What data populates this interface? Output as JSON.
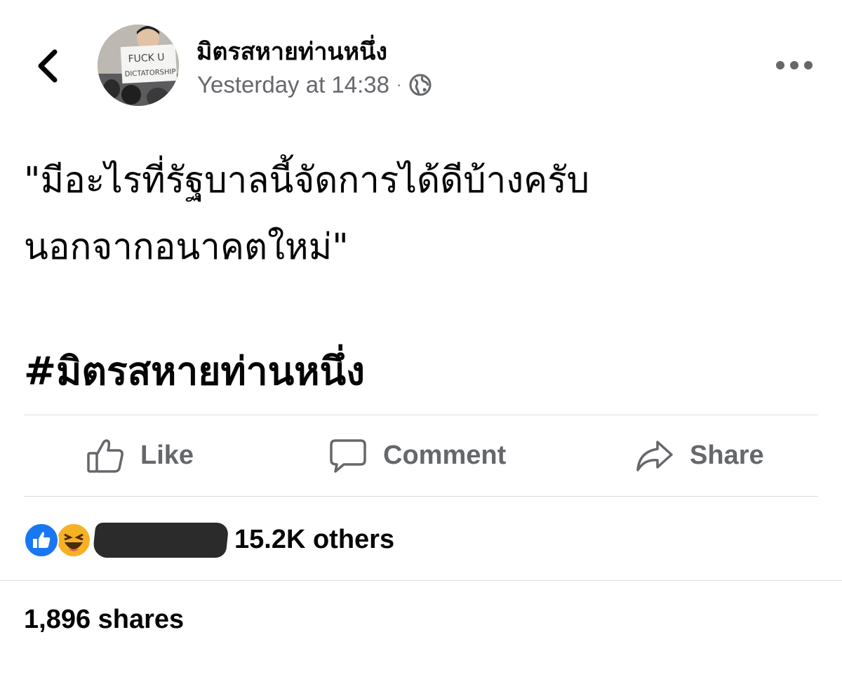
{
  "header": {
    "author_name": "มิตรสหายท่านหนึ่ง",
    "timestamp": "Yesterday at 14:38",
    "separator": "·",
    "privacy_icon": "globe-icon",
    "back_icon": "chevron-left-icon",
    "more_icon": "more-horizontal-icon",
    "avatar_sign_text": [
      "FUCK U",
      "DICTATORSHIP"
    ]
  },
  "post": {
    "text_lines": [
      "\"มีอะไรที่รัฐบาลนี้จัดการได้ดีบ้างครับ",
      "นอกจากอนาคตใหม่\""
    ],
    "hashtag": "#มิตรสหายท่านหนึ่ง"
  },
  "actions": {
    "like_label": "Like",
    "comment_label": "Comment",
    "share_label": "Share"
  },
  "reactions": {
    "icons": [
      "like-react-icon",
      "haha-react-icon"
    ],
    "summary_text": "15.2K others"
  },
  "shares": {
    "count_text": "1,896 shares"
  },
  "colors": {
    "text_primary": "#050505",
    "text_secondary": "#65676b",
    "divider": "#dadde1",
    "like_blue": "#1877f2",
    "haha_yellow": "#f7b125"
  }
}
